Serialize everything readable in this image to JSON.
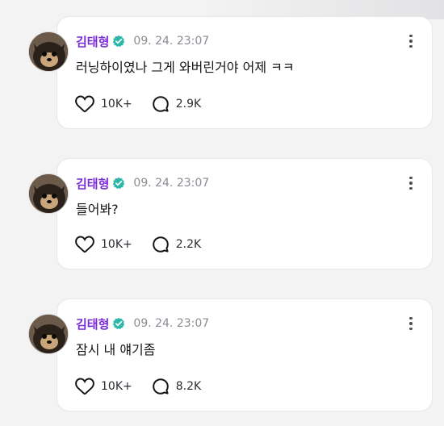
{
  "posts": [
    {
      "author": "김태형",
      "time": "09. 24. 23:07",
      "text": "러닝하이였나 그게 와버린거야 어제 ㅋㅋ",
      "likes": "10K+",
      "comments": "2.9K"
    },
    {
      "author": "김태형",
      "time": "09. 24. 23:07",
      "text": "들어봐?",
      "likes": "10K+",
      "comments": "2.2K"
    },
    {
      "author": "김태형",
      "time": "09. 24. 23:07",
      "text": "잠시 내 얘기좀",
      "likes": "10K+",
      "comments": "8.2K"
    }
  ],
  "icons": {
    "verified": "verified-badge-icon",
    "like": "heart-icon",
    "comment": "comment-bubble-icon",
    "more": "more-vertical-icon"
  },
  "colors": {
    "author": "#7a2bd6",
    "verified": "#2bb8a8",
    "time": "#8b8b93",
    "text": "#16161a"
  }
}
